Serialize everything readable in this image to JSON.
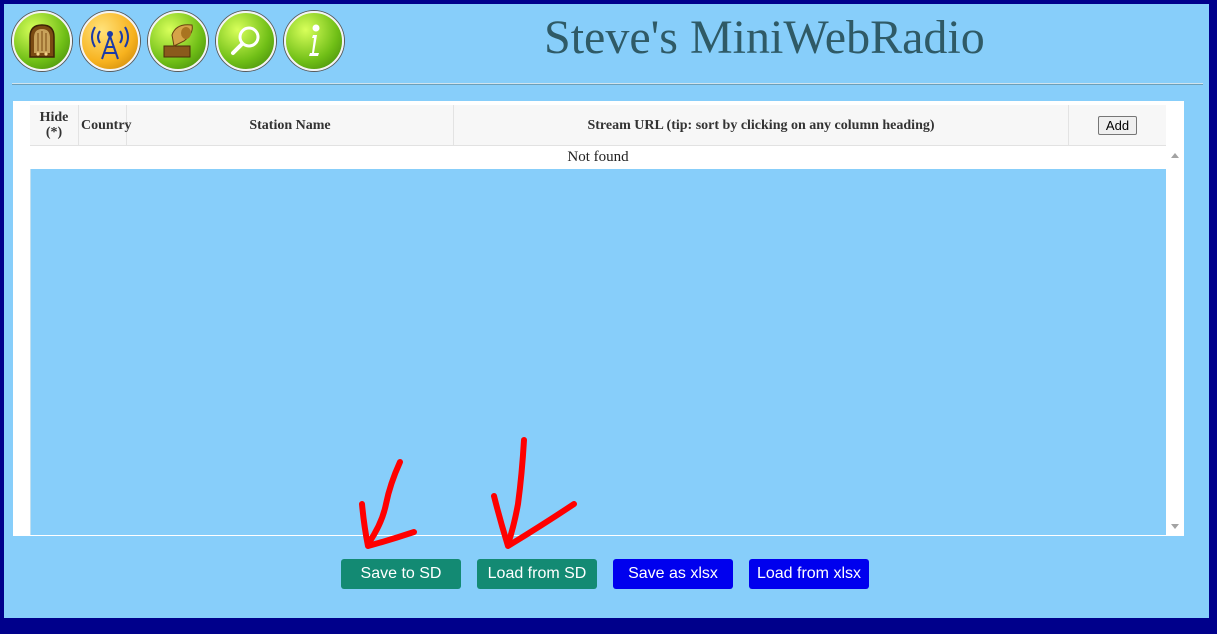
{
  "header": {
    "title": "Steve's MiniWebRadio",
    "nav_icons": [
      "radio-icon",
      "antenna-icon",
      "gramophone-icon",
      "search-icon",
      "info-icon"
    ]
  },
  "table": {
    "columns": {
      "hide": "Hide (*)",
      "country": "Country",
      "station_name": "Station Name",
      "stream_url": "Stream URL (tip: sort by clicking on any column heading)"
    },
    "add_label": "Add",
    "empty_message": "Not found"
  },
  "buttons": {
    "save_sd": "Save to SD",
    "load_sd": "Load from SD",
    "save_xlsx": "Save as xlsx",
    "load_xlsx": "Load from xlsx"
  },
  "colors": {
    "frame": "#00008b",
    "background": "#87cefa",
    "title": "#2f5a66",
    "sd_button": "#138a73",
    "xlsx_button": "#0000ee",
    "annotation": "#ff0000"
  }
}
